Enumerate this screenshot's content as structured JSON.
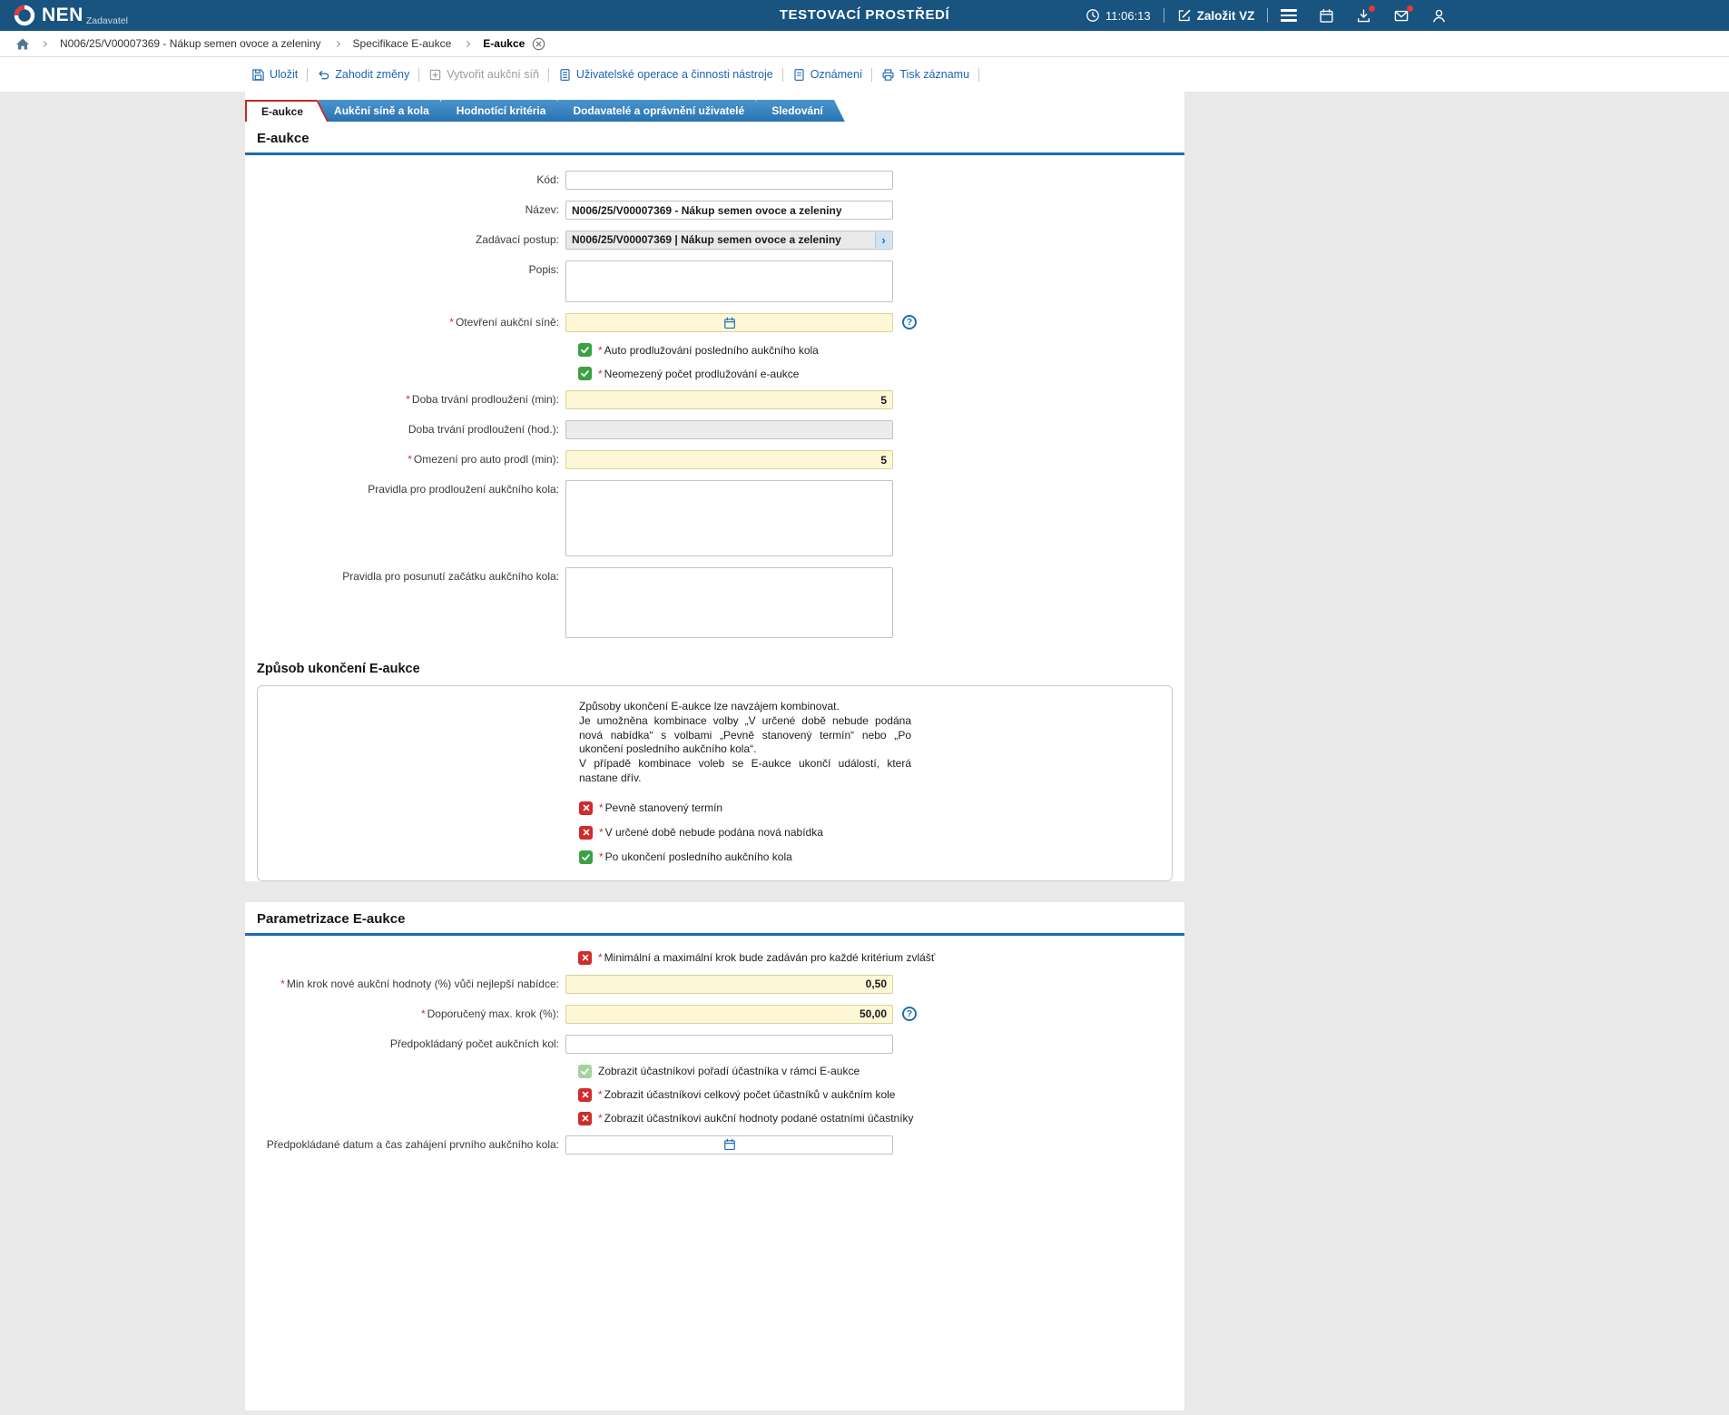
{
  "ui": {
    "required": "*"
  },
  "icons": {
    "help": "?",
    "chevron": "›"
  },
  "header": {
    "brand": "NEN",
    "brand_sub": "Zadavatel",
    "env_title": "TESTOVACÍ PROSTŘEDÍ",
    "time": "11:06:13",
    "create_button": "Založit VZ"
  },
  "breadcrumb": {
    "crumb1": "N006/25/V00007369 - Nákup semen ovoce a zeleniny",
    "crumb2": "Specifikace E-aukce",
    "crumb3": "E-aukce"
  },
  "toolbar": {
    "save": "Uložit",
    "discard": "Zahodit změny",
    "create_room": "Vytvořit aukční síň",
    "user_ops": "Uživatelské operace a činnosti nástroje",
    "notices": "Oznámení",
    "print": "Tisk záznamu"
  },
  "tabs": {
    "eaukce": "E-aukce",
    "sine": "Aukční síně a kola",
    "kriteria": "Hodnotící kritéria",
    "dodavatele": "Dodavatelé a oprávnění uživatelé",
    "sledovani": "Sledování"
  },
  "eaukce": {
    "section_title": "E-aukce",
    "kod_label": "Kód:",
    "nazev_label": "Název:",
    "nazev_value": "N006/25/V00007369 - Nákup semen ovoce a zeleniny",
    "postup_label": "Zadávací postup:",
    "postup_value": "N006/25/V00007369 | Nákup semen ovoce a zeleniny",
    "popis_label": "Popis:",
    "otevreni_label": "Otevření aukční síně:",
    "cb_auto_label": "Auto prodlužování posledního aukčního kola",
    "cb_neomezene_label": "Neomezený počet prodlužování e-aukce",
    "doba_min_label": "Doba trvání prodloužení (min):",
    "doba_min_value": "5",
    "doba_hod_label": "Doba trvání prodloužení (hod.):",
    "omezeni_label": "Omezení pro auto prodl (min):",
    "omezeni_value": "5",
    "pravidla_prodl_label": "Pravidla pro prodloužení aukčního kola:",
    "pravidla_posun_label": "Pravidla pro posunutí začátku aukčního kola:"
  },
  "zpusob": {
    "section_title": "Způsob ukončení E-aukce",
    "info1": "Způsoby ukončení E-aukce lze navzájem kombinovat.",
    "info2": "Je umožněna kombinace volby „V určené době nebude podána nová nabídka“ s volbami „Pevně stanovený termín“ nebo „Po ukončení posledního aukčního kola“.",
    "info3": "V případě kombinace voleb se E-aukce ukončí událostí, která nastane dřív.",
    "cb_pevny_label": "Pevně stanovený termín",
    "cb_urcena_label": "V určené době nebude podána nová nabídka",
    "cb_poukonceni_label": "Po ukončení posledního aukčního kola"
  },
  "parametrizace": {
    "section_title": "Parametrizace E-aukce",
    "cb_krok_label": "Minimální a maximální krok bude zadáván pro každé kritérium zvlášť",
    "minkrok_label": "Min krok nové aukční hodnoty (%) vůči nejlepší nabídce:",
    "minkrok_value": "0,50",
    "maxkrok_label": "Doporučený max. krok (%):",
    "maxkrok_value": "50,00",
    "pocetkol_label": "Předpokládaný počet aukčních kol:",
    "cb_poradi_label": "Zobrazit účastníkovi pořadí účastníka v rámci E-aukce",
    "cb_pocet_label": "Zobrazit účastníkovi celkový počet účastníků v aukčním kole",
    "cb_hodnoty_label": "Zobrazit účastníkovi aukční hodnoty podané ostatními účastníky",
    "datum_label": "Předpokládané datum a čas zahájení prvního aukčního kola:"
  }
}
